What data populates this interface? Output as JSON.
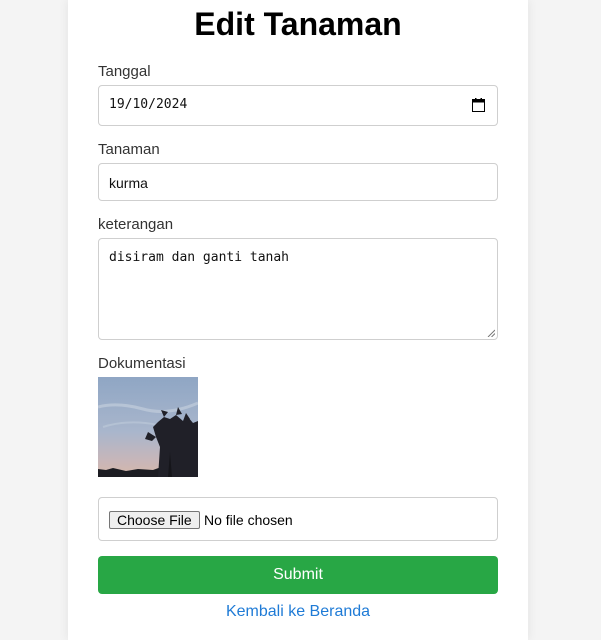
{
  "page": {
    "title": "Edit Tanaman"
  },
  "form": {
    "tanggal": {
      "label": "Tanggal",
      "value": "19/10/2024",
      "icon": "calendar-icon"
    },
    "tanaman": {
      "label": "Tanaman",
      "value": "kurma"
    },
    "keterangan": {
      "label": "keterangan",
      "value": "disiram dan ganti tanah"
    },
    "dokumentasi": {
      "label": "Dokumentasi",
      "choose_file_label": "Choose File",
      "no_file_text": "No file chosen"
    },
    "submit_label": "Submit",
    "back_link": "Kembali ke Beranda"
  },
  "colors": {
    "submit_bg": "#28a745",
    "link": "#1f7bd6",
    "page_bg": "#f4f4f4"
  }
}
